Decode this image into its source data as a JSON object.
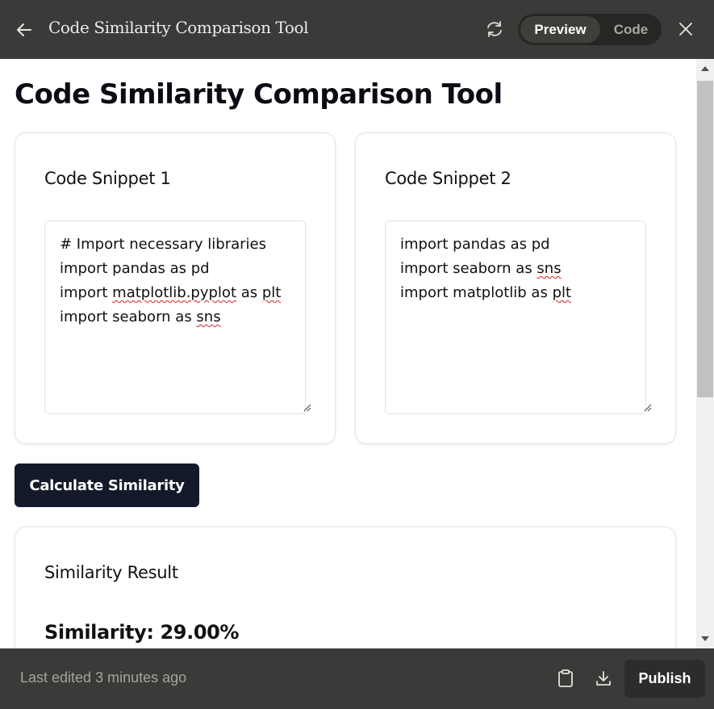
{
  "topbar": {
    "title": "Code Similarity Comparison Tool",
    "toggle_preview": "Preview",
    "toggle_code": "Code"
  },
  "page": {
    "title": "Code Similarity Comparison Tool"
  },
  "snippet1": {
    "label": "Code Snippet 1",
    "lines": [
      [
        "# Import necessary libraries"
      ],
      [
        "import pandas as pd"
      ],
      [
        "import ",
        "matplotlib.pyplot",
        " as ",
        "plt"
      ],
      [
        "import seaborn as ",
        "sns"
      ]
    ]
  },
  "snippet2": {
    "label": "Code Snippet 2",
    "lines": [
      [
        "import pandas as pd"
      ],
      [
        "import seaborn as ",
        "sns"
      ],
      [
        "import matplotlib as ",
        "plt"
      ]
    ]
  },
  "calculate_button": "Calculate Similarity",
  "result": {
    "label": "Similarity Result",
    "value": "Similarity: 29.00%"
  },
  "bottombar": {
    "last_edited": "Last edited 3 minutes ago",
    "publish": "Publish"
  },
  "icons": {
    "back": "arrow-left-icon",
    "refresh": "refresh-icon",
    "close": "close-icon",
    "clipboard": "clipboard-icon",
    "download": "download-icon"
  },
  "colors": {
    "topbar_bg": "#3a3a38",
    "button_bg": "#141a2a",
    "spell_underline": "#dd2222"
  }
}
